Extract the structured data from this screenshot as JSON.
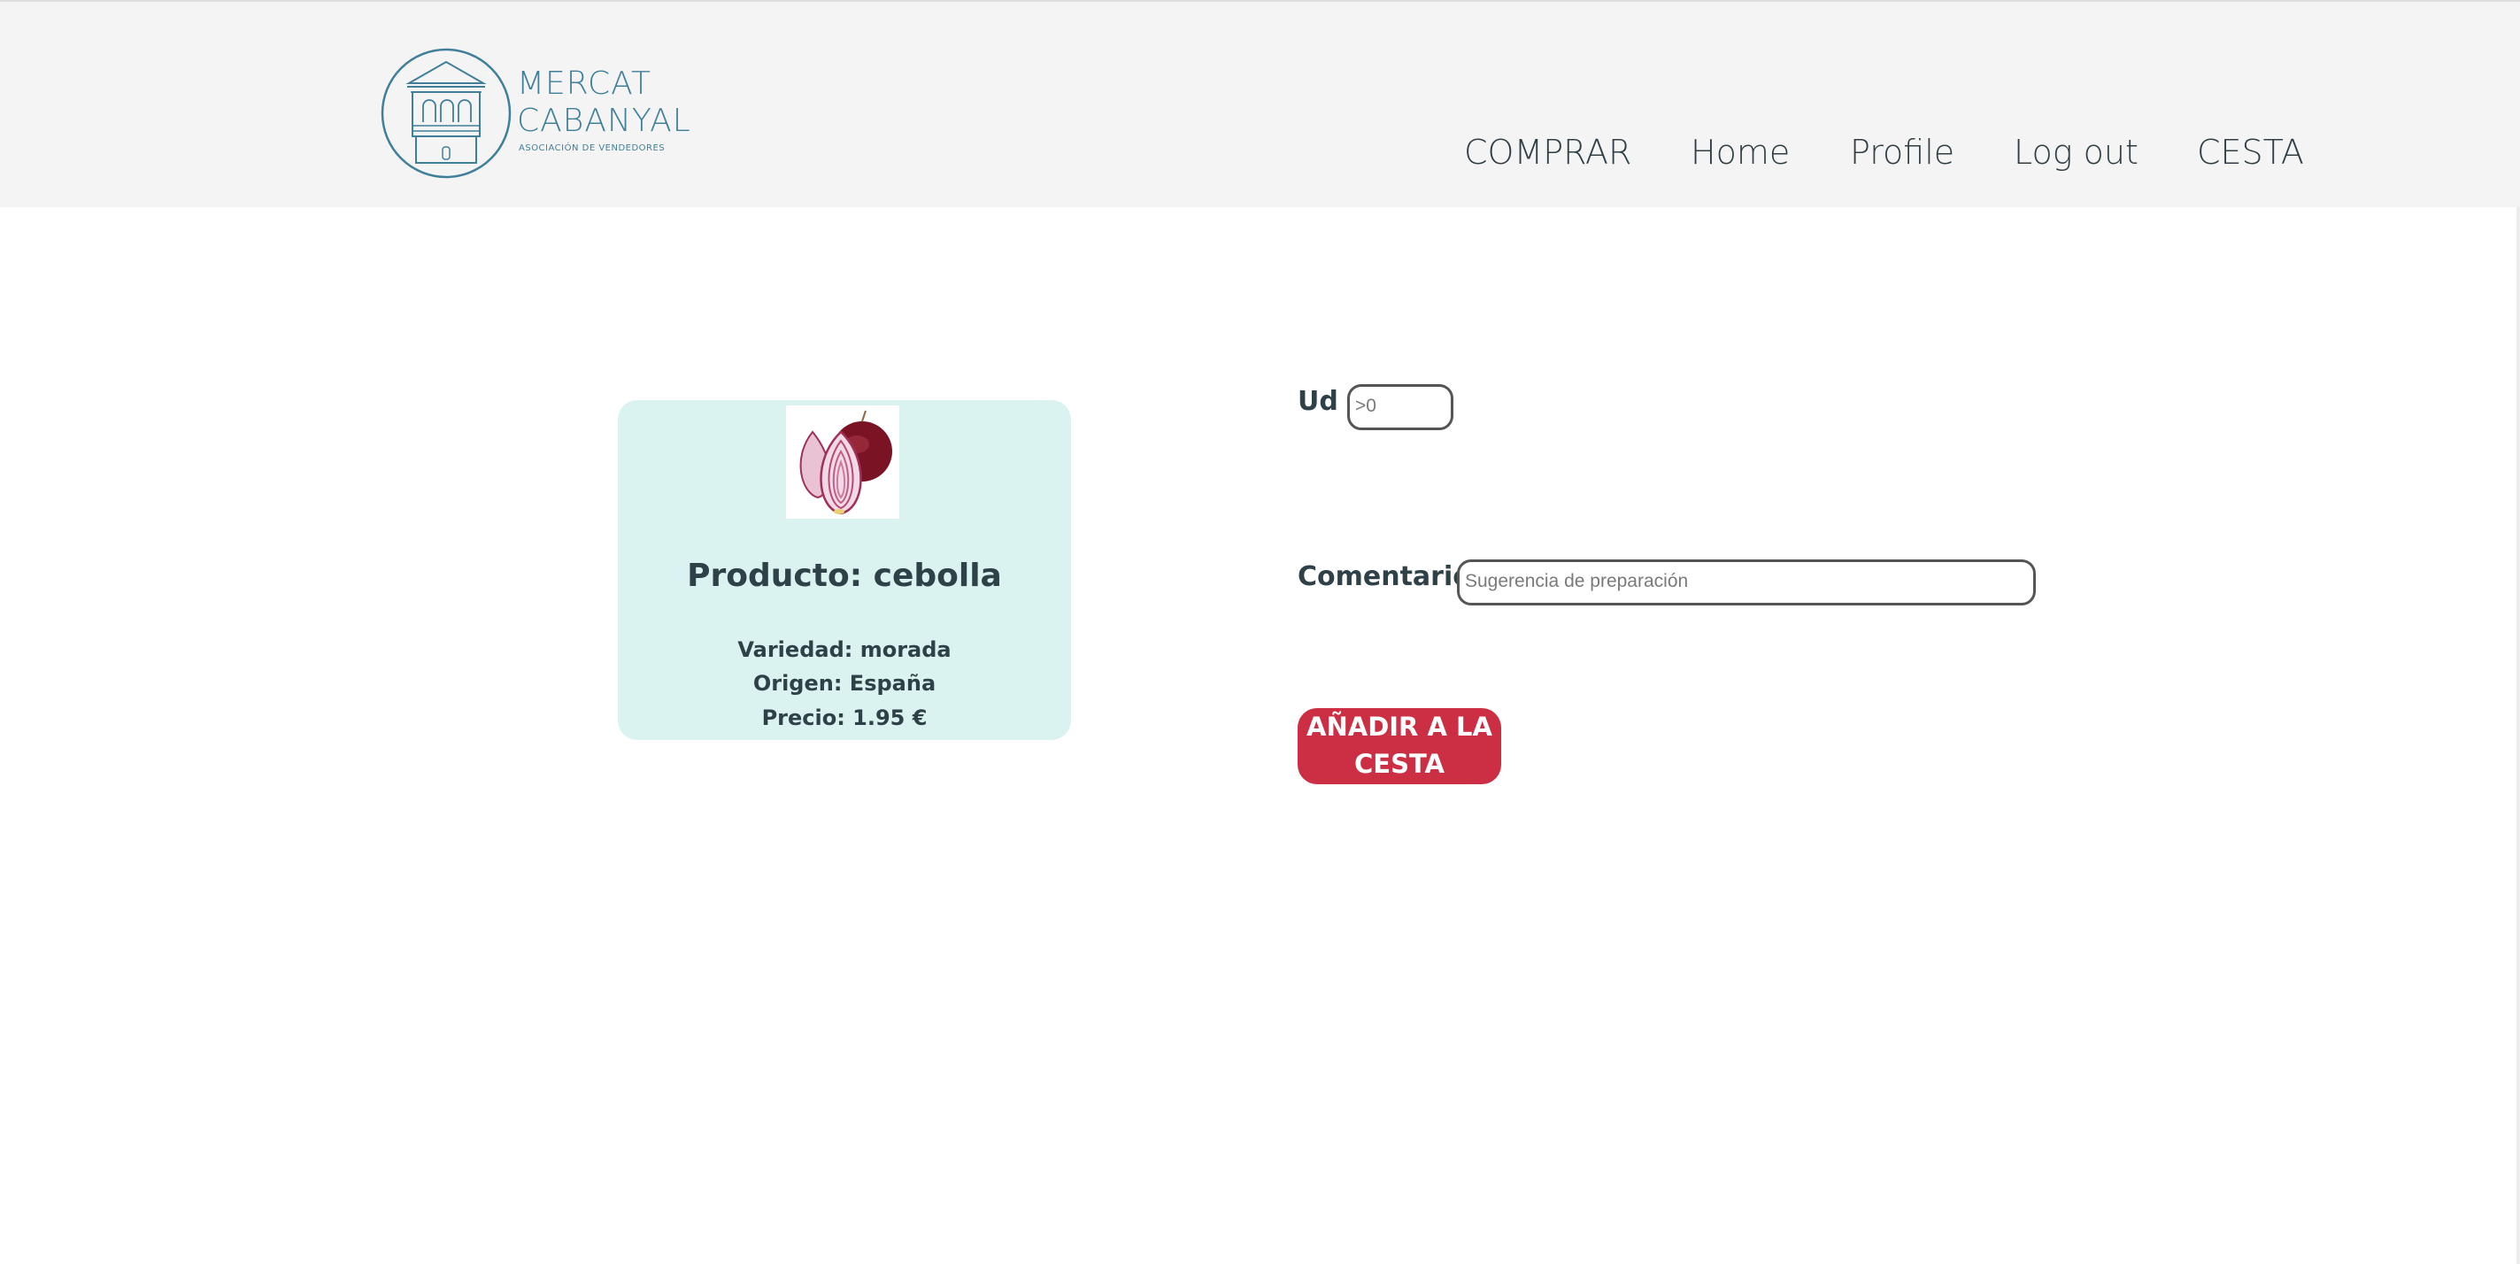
{
  "header": {
    "logo": {
      "line1": "MERCAT",
      "line2": "CABANYAL",
      "subtitle": "ASOCIACIÓN DE VENDEDORES",
      "color": "#3f7f9a"
    },
    "nav": [
      {
        "label": "COMPRAR"
      },
      {
        "label": "Home"
      },
      {
        "label": "Profile"
      },
      {
        "label": "Log out"
      },
      {
        "label": "CESTA"
      }
    ]
  },
  "product": {
    "title": "Producto: cebolla",
    "variety": "Variedad: morada",
    "origin": "Origen: España",
    "price": "Precio: 1.95 €",
    "image_icon": "red-onion-image"
  },
  "form": {
    "units_label": "Ud :",
    "units_placeholder": ">0",
    "comment_label": "Comentario :",
    "comment_placeholder": "Sugerencia de preparación",
    "add_button_line1": "AÑADIR A LA",
    "add_button_line2": "CESTA"
  },
  "colors": {
    "header_bg": "#f4f4f4",
    "card_bg": "#daf3f1",
    "button_bg": "#cc2f44",
    "text": "#2f4148"
  }
}
